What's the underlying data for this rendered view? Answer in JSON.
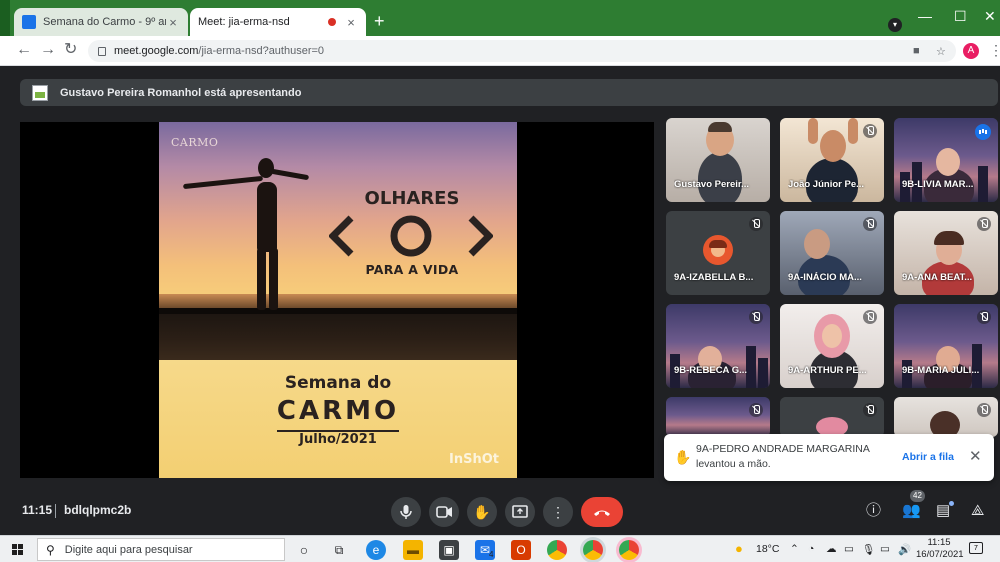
{
  "browser": {
    "tabs": [
      {
        "title": "Semana do Carmo - 9º ano EF AI",
        "close": "×"
      },
      {
        "title": "Meet: jia-erma-nsd",
        "close": "×"
      }
    ],
    "new_tab": "+",
    "url_host": "meet.google.com",
    "url_path": "/jia-erma-nsd?authuser=0",
    "profile_initial": "A",
    "window_controls": [
      "—",
      "☐",
      "✕"
    ]
  },
  "meet": {
    "presenting_text": "Gustavo Pereira Romanhol está apresentando",
    "slide": {
      "brand": "CARMO",
      "line1": "OLHARES",
      "eye": "<O>",
      "line2": "PARA A VIDA",
      "semana": "Semana do",
      "carmo": "CARMO",
      "date": "Julho/2021",
      "watermark": "InShOt"
    },
    "participants": [
      {
        "name": "Gustavo Pereir...",
        "state": "normal"
      },
      {
        "name": "João Júnior Pe...",
        "state": "muted"
      },
      {
        "name": "9B-LIVIA MAR...",
        "state": "speaking"
      },
      {
        "name": "9A-IZABELLA B...",
        "state": "muted"
      },
      {
        "name": "9A-INÁCIO MA...",
        "state": "muted"
      },
      {
        "name": "9A-ANA BEAT...",
        "state": "muted"
      },
      {
        "name": "9B-REBECA G...",
        "state": "muted"
      },
      {
        "name": "9A-ARTHUR PE...",
        "state": "muted"
      },
      {
        "name": "9B-MARIA JULI...",
        "state": "muted"
      },
      {
        "name": "",
        "state": "muted"
      },
      {
        "name": "",
        "state": "muted"
      },
      {
        "name": "",
        "state": "muted"
      }
    ],
    "toast": {
      "name": "9A-PEDRO ANDRADE MARGARINA",
      "message": "levantou a mão.",
      "action": "Abrir a fila",
      "close": "✕"
    },
    "time": "11:15",
    "meeting_code": "bdlqlpmc2b",
    "participant_count": "42"
  },
  "taskbar": {
    "search_placeholder": "Digite aqui para pesquisar",
    "weather": "18°C",
    "clock_time": "11:15",
    "clock_date": "16/07/2021",
    "notification_count": "7",
    "mail_badge": "4"
  }
}
